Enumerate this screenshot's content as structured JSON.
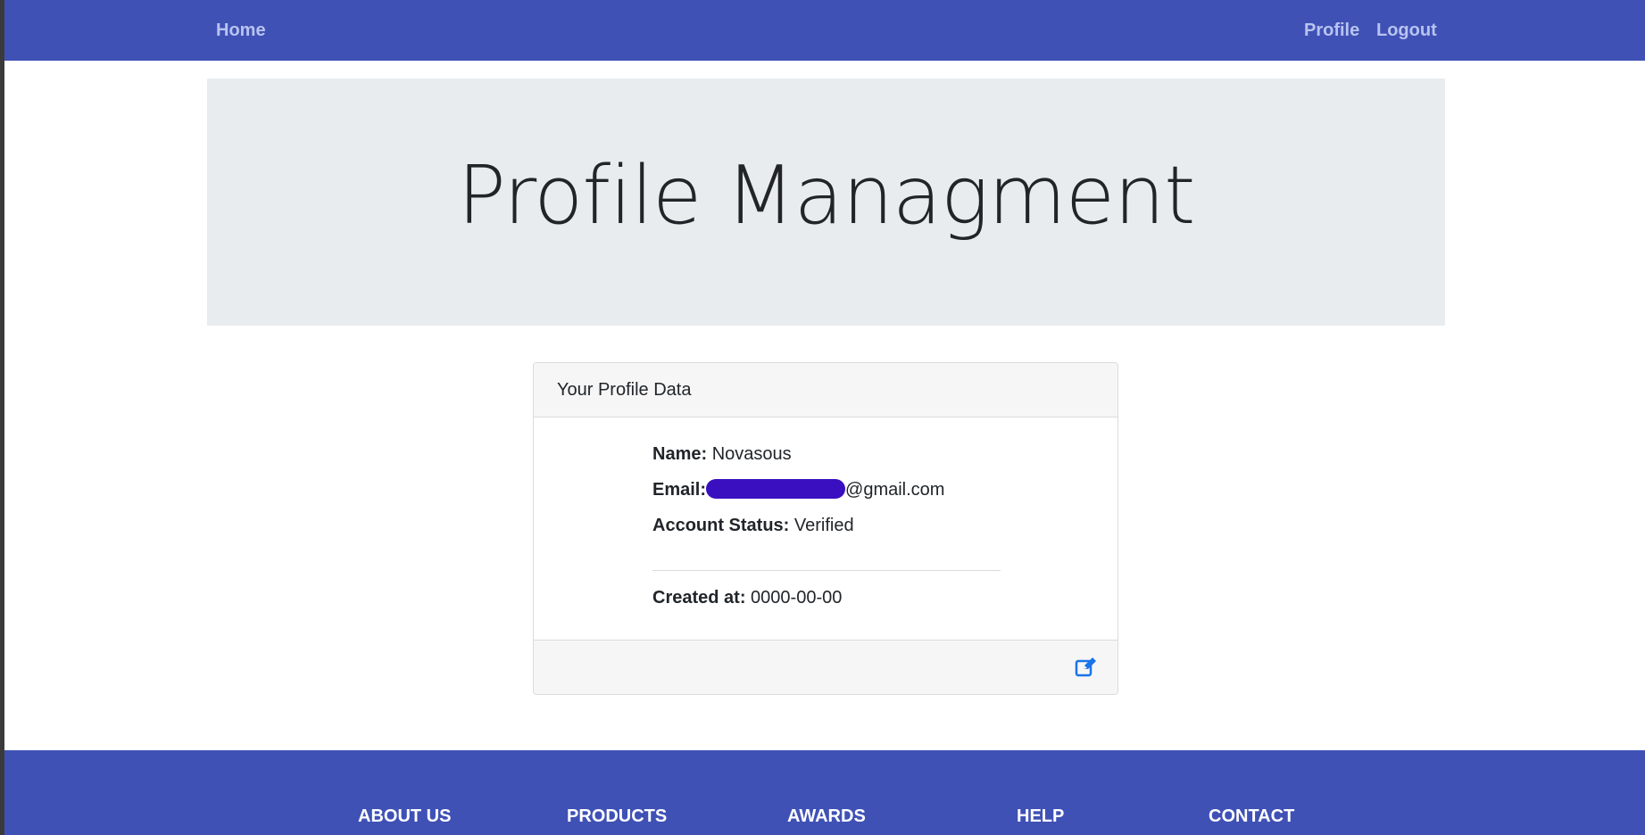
{
  "nav": {
    "home": "Home",
    "profile": "Profile",
    "logout": "Logout"
  },
  "jumbotron": {
    "title": "Profile Managment"
  },
  "card": {
    "header": "Your Profile Data",
    "name_label": "Name:",
    "name_value": "Novasous",
    "email_label": "Email:",
    "email_visible_suffix": "@gmail.com",
    "status_label": "Account Status:",
    "status_value": "Verified",
    "created_label": "Created at:",
    "created_value": "0000-00-00",
    "edit_icon": "edit-icon"
  },
  "footer": {
    "links": [
      "ABOUT US",
      "PRODUCTS",
      "AWARDS",
      "HELP",
      "CONTACT"
    ]
  },
  "colors": {
    "navbar": "#3f51b5",
    "nav_link": "#b9c3f0",
    "jumbotron_bg": "#e9ecef",
    "card_header_bg": "#f6f6f6",
    "redaction": "#3a0fbf",
    "edit_icon": "#1a73e8"
  }
}
